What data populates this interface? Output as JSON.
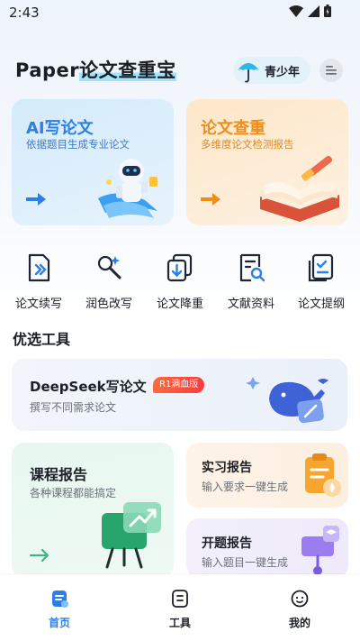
{
  "status": {
    "time": "2:43"
  },
  "header": {
    "title_prefix": "Paper",
    "title_main": "论文查重宝",
    "youth_mode_label": "青少年"
  },
  "feature_cards": [
    {
      "title": "AI写论文",
      "subtitle": "依据题目生成专业论文"
    },
    {
      "title": "论文查重",
      "subtitle": "多维度论文检测报告"
    }
  ],
  "quick_tools": [
    {
      "label": "论文续写",
      "icon": "document-continue-icon"
    },
    {
      "label": "润色改写",
      "icon": "magic-wand-icon"
    },
    {
      "label": "论文降重",
      "icon": "document-reduce-icon"
    },
    {
      "label": "文献资料",
      "icon": "document-search-icon"
    },
    {
      "label": "论文提纲",
      "icon": "outline-checklist-icon"
    }
  ],
  "section": {
    "title": "优选工具"
  },
  "deepseek": {
    "title": "DeepSeek写论文",
    "badge": "R1满血版",
    "subtitle": "撰写不同需求论文"
  },
  "course": {
    "title": "课程报告",
    "subtitle": "各种课程都能搞定"
  },
  "internship": {
    "title": "实习报告",
    "subtitle": "输入要求一键生成"
  },
  "opening": {
    "title": "开题报告",
    "subtitle": "输入题目一键生成"
  },
  "bottom_nav": [
    {
      "label": "首页",
      "active": true
    },
    {
      "label": "工具",
      "active": false
    },
    {
      "label": "我的",
      "active": false
    }
  ],
  "colors": {
    "accent_blue": "#2d7fe6",
    "accent_orange": "#ee8d18",
    "badge_red": "#f53d3d"
  }
}
